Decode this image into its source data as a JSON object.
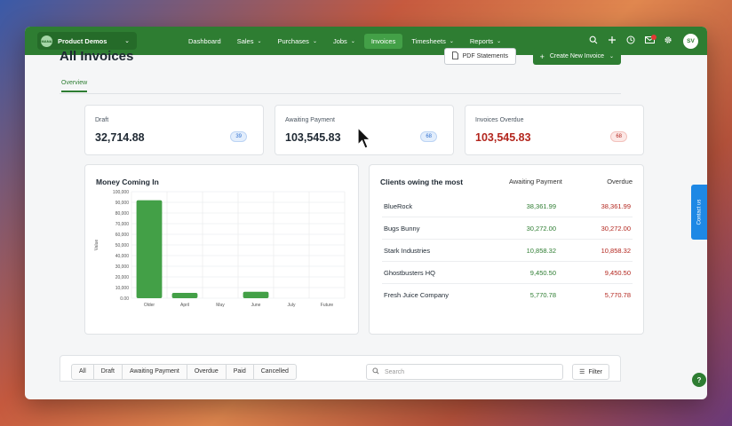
{
  "org": {
    "name": "Product Demos",
    "logo_text": "MANA"
  },
  "nav": {
    "items": [
      {
        "label": "Dashboard",
        "dropdown": false,
        "active": false
      },
      {
        "label": "Sales",
        "dropdown": true,
        "active": false
      },
      {
        "label": "Purchases",
        "dropdown": true,
        "active": false
      },
      {
        "label": "Jobs",
        "dropdown": true,
        "active": false
      },
      {
        "label": "Invoices",
        "dropdown": false,
        "active": true
      },
      {
        "label": "Timesheets",
        "dropdown": true,
        "active": false
      },
      {
        "label": "Reports",
        "dropdown": true,
        "active": false
      }
    ],
    "avatar": "SV"
  },
  "page": {
    "title": "All Invoices",
    "pdf_button": "PDF Statements",
    "create_button": "Create New Invoice",
    "tab": "Overview"
  },
  "stats": [
    {
      "label": "Draft",
      "value": "32,714.88",
      "badge": "39",
      "color": "blue"
    },
    {
      "label": "Awaiting Payment",
      "value": "103,545.83",
      "badge": "68",
      "color": "blue"
    },
    {
      "label": "Invoices Overdue",
      "value": "103,545.83",
      "badge": "68",
      "color": "red"
    }
  ],
  "money_panel": {
    "title": "Money Coming In"
  },
  "chart_data": {
    "type": "bar",
    "title": "Money Coming In",
    "categories": [
      "Older",
      "April",
      "May",
      "June",
      "July",
      "Future"
    ],
    "values": [
      92000,
      5000,
      0,
      6000,
      0,
      0
    ],
    "ylabel": "Value",
    "ylim": [
      0,
      100000
    ],
    "yticks": [
      "0.00",
      "10,000",
      "20,000",
      "30,000",
      "40,000",
      "50,000",
      "60,000",
      "70,000",
      "80,000",
      "90,000",
      "100,000"
    ],
    "grid": true,
    "bar_color": "#43a047"
  },
  "clients_panel": {
    "title": "Clients owing the most",
    "col_awaiting": "Awaiting Payment",
    "col_overdue": "Overdue",
    "rows": [
      {
        "name": "BlueRock",
        "awaiting": "38,361.99",
        "overdue": "38,361.99"
      },
      {
        "name": "Bugs Bunny",
        "awaiting": "30,272.00",
        "overdue": "30,272.00"
      },
      {
        "name": "Stark Industries",
        "awaiting": "10,858.32",
        "overdue": "10,858.32"
      },
      {
        "name": "Ghostbusters HQ",
        "awaiting": "9,450.50",
        "overdue": "9,450.50"
      },
      {
        "name": "Fresh Juice Company",
        "awaiting": "5,770.78",
        "overdue": "5,770.78"
      }
    ]
  },
  "filters": {
    "tabs": [
      "All",
      "Draft",
      "Awaiting Payment",
      "Overdue",
      "Paid",
      "Cancelled"
    ],
    "search_placeholder": "Search",
    "filter_button": "Filter"
  },
  "contact_tab": "Contact us",
  "help_label": "?",
  "colors": {
    "brand": "#2e7d32",
    "overdue": "#b3261e",
    "link_blue": "#2f6fce"
  }
}
